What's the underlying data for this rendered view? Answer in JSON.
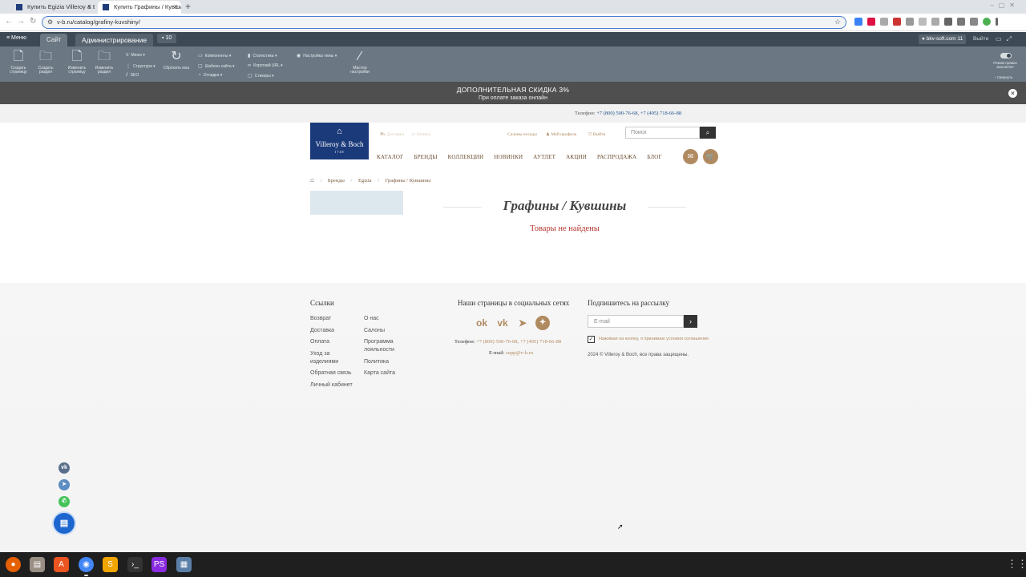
{
  "browser": {
    "tabs": [
      {
        "label": "Купить Egizia Villeroy & B"
      },
      {
        "label": "Купить Графины / Кувши"
      }
    ],
    "url": "v-b.ru/catalog/grafiny-kuvshiny/"
  },
  "admin": {
    "menu_label": "Меню",
    "tab_site": "Сайт",
    "tab_admin": "Администрирование",
    "notifications": "10",
    "user": "bkv-soft.com 11",
    "logout": "Выйти",
    "tools": {
      "create_page": "Создать страницу",
      "create_section": "Создать раздел",
      "edit_page": "Изменить страницу",
      "edit_section": "Изменить раздел",
      "menu": "Меню",
      "structure": "Структура",
      "seo": "SEO",
      "reset_cache": "Сбросить кеш",
      "components": "Компоненты",
      "site_template": "Шаблон сайта",
      "debug": "Отладка",
      "stats": "Статистика",
      "short_urls": "Короткий URL",
      "stickers": "Стикеры",
      "theme_settings": "Настройка темы",
      "wizard": "Мастер настройки",
      "edit_mode": "Режим правки выключен",
      "collapse": "Свернуть"
    }
  },
  "promo": {
    "line1": "ДОПОЛНИТЕЛЬНАЯ СКИДКА 3%",
    "line2": "При оплате заказа онлайн"
  },
  "phonebar": {
    "label": "Телефон: ",
    "numbers": "+7 (800) 500-76-68, +7 (495) 718-66-88"
  },
  "logo": {
    "name": "Villeroy & Boch",
    "year": "1748"
  },
  "header": {
    "delivery": "Доставка",
    "payment": "Оплата",
    "salons": "Салоны посуды",
    "profile": "Мой профиль",
    "logout": "Выйти",
    "search_placeholder": "Поиск"
  },
  "nav": [
    "КАТАЛОГ",
    "БРЕНДЫ",
    "КОЛЛЕКЦИИ",
    "НОВИНКИ",
    "АУТЛЕТ",
    "АКЦИИ",
    "РАСПРОДАЖА",
    "БЛОГ"
  ],
  "breadcrumb": [
    "Бренды",
    "Egizia",
    "Графины / Кувшины"
  ],
  "page": {
    "title": "Графины / Кувшины",
    "empty_message": "Товары не найдены"
  },
  "footer": {
    "links_title": "Ссылки",
    "links_col1": [
      "Возврат",
      "Доставка",
      "Оплата",
      "Уход за изделиями",
      "Обратная связь",
      "Личный кабинет"
    ],
    "links_col2": [
      "О нас",
      "Салоны",
      "Программа лояльности",
      "Политика",
      "Карта сайта"
    ],
    "social_title": "Наши страницы в социальных сетях",
    "phone_label": "Телефон: ",
    "phone_numbers": "+7 (800) 500-76-68, +7 (495) 718-66-88",
    "email_label": "E-mail: ",
    "email": "supp@v-b.ru",
    "newsletter_title": "Подпишитесь на рассылку",
    "email_placeholder": "E-mail",
    "agree_text": "Нажимая на кнопку, я принимаю условия соглашения",
    "copyright": "2024 © Villeroy & Boch, все права защищены."
  }
}
